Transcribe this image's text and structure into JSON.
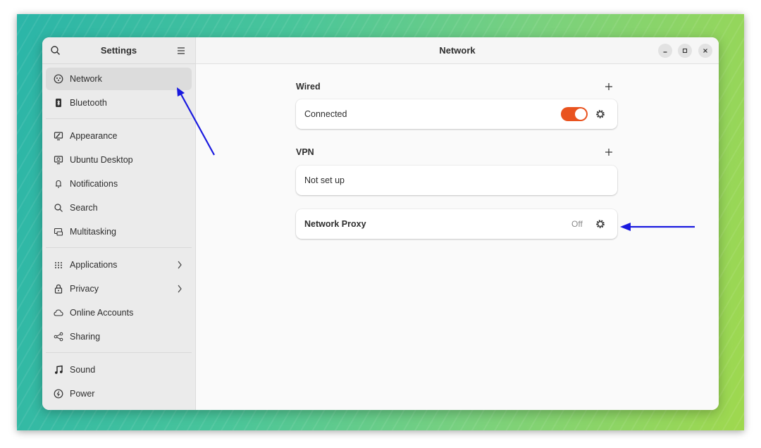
{
  "sidebar": {
    "title": "Settings",
    "items": [
      {
        "label": "Network",
        "icon": "network-icon"
      },
      {
        "label": "Bluetooth",
        "icon": "bluetooth-icon"
      },
      {
        "label": "Appearance",
        "icon": "appearance-icon"
      },
      {
        "label": "Ubuntu Desktop",
        "icon": "ubuntu-desktop-icon"
      },
      {
        "label": "Notifications",
        "icon": "bell-icon"
      },
      {
        "label": "Search",
        "icon": "search-icon"
      },
      {
        "label": "Multitasking",
        "icon": "multitasking-icon"
      },
      {
        "label": "Applications",
        "icon": "grid-icon"
      },
      {
        "label": "Privacy",
        "icon": "lock-icon"
      },
      {
        "label": "Online Accounts",
        "icon": "cloud-icon"
      },
      {
        "label": "Sharing",
        "icon": "share-icon"
      },
      {
        "label": "Sound",
        "icon": "music-note-icon"
      },
      {
        "label": "Power",
        "icon": "power-icon"
      }
    ]
  },
  "main": {
    "title": "Network",
    "wired": {
      "title": "Wired",
      "status": "Connected",
      "enabled": true
    },
    "vpn": {
      "title": "VPN",
      "status": "Not set up"
    },
    "proxy": {
      "label": "Network Proxy",
      "value": "Off"
    }
  },
  "colors": {
    "accent": "#e9531f",
    "annotation": "#1a1adf"
  }
}
